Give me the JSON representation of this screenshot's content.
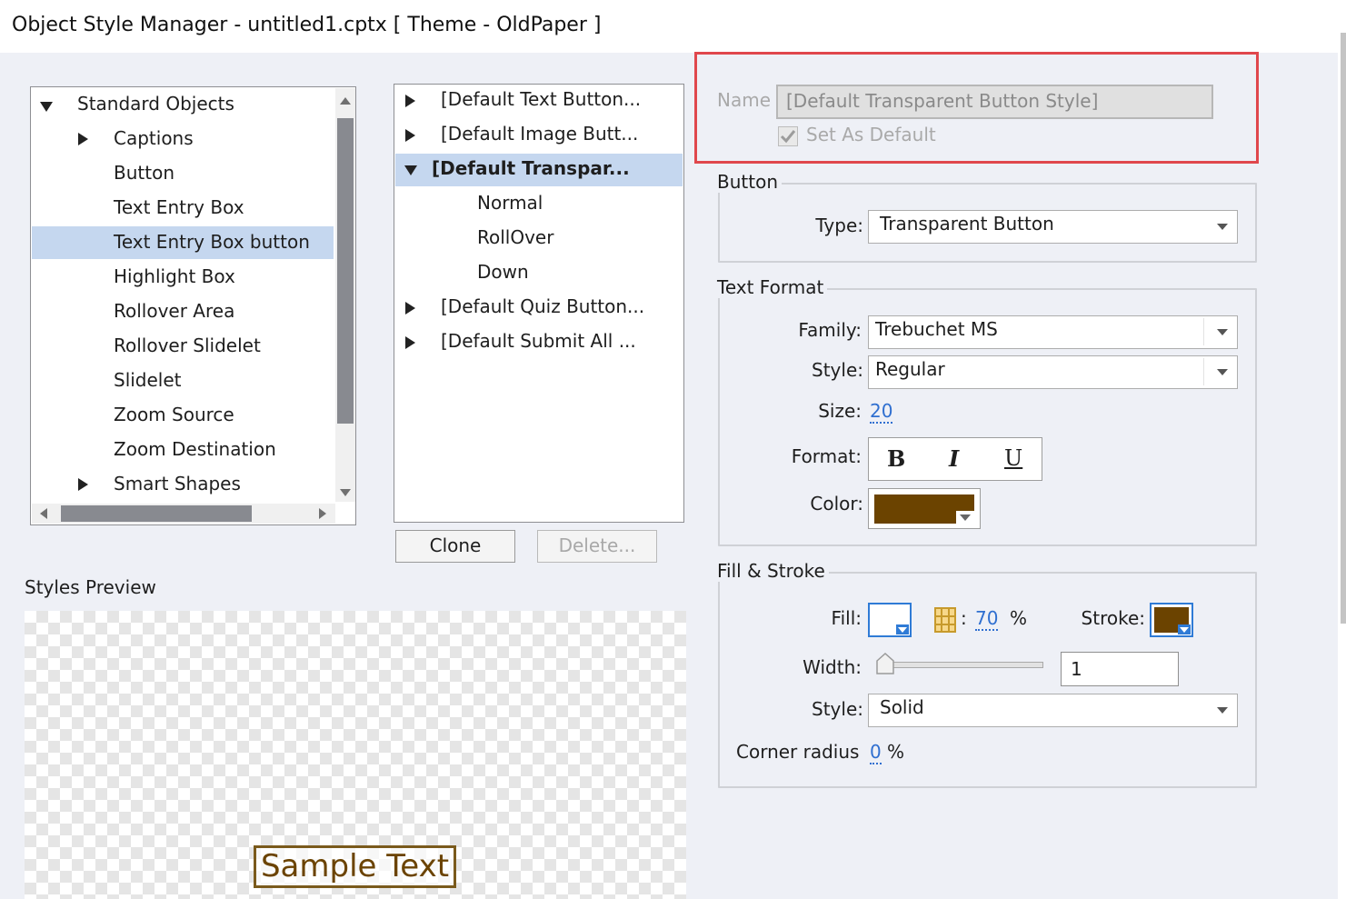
{
  "window": {
    "title": "Object Style Manager - untitled1.cptx [ Theme - OldPaper ]"
  },
  "categories": {
    "root": "Standard Objects",
    "items": [
      {
        "label": "Captions",
        "expandable": true
      },
      {
        "label": "Button",
        "expandable": false
      },
      {
        "label": "Text Entry Box",
        "expandable": false
      },
      {
        "label": "Text Entry Box button",
        "expandable": false,
        "selected": true
      },
      {
        "label": "Highlight Box",
        "expandable": false
      },
      {
        "label": "Rollover Area",
        "expandable": false
      },
      {
        "label": "Rollover Slidelet",
        "expandable": false
      },
      {
        "label": "Slidelet",
        "expandable": false
      },
      {
        "label": "Zoom Source",
        "expandable": false
      },
      {
        "label": "Zoom Destination",
        "expandable": false
      },
      {
        "label": "Smart Shapes",
        "expandable": true
      }
    ]
  },
  "styles": {
    "items": [
      {
        "label": "[Default Text Button..."
      },
      {
        "label": "[Default Image Butt..."
      },
      {
        "label": "[Default Transpar...",
        "selected": true,
        "expanded": true
      },
      {
        "label": "Normal",
        "child": true
      },
      {
        "label": "RollOver",
        "child": true
      },
      {
        "label": "Down",
        "child": true
      },
      {
        "label": "[Default Quiz Button..."
      },
      {
        "label": "[Default Submit All ..."
      }
    ],
    "clone_label": "Clone",
    "delete_label": "Delete..."
  },
  "preview": {
    "label": "Styles Preview",
    "sample_text": "Sample Text"
  },
  "name_section": {
    "name_label": "Name",
    "name_value": "[Default Transparent Button Style]",
    "set_default_label": "Set As Default"
  },
  "button_group": {
    "title": "Button",
    "type_label": "Type:",
    "type_value": "Transparent Button"
  },
  "text_format": {
    "title": "Text Format",
    "family_label": "Family:",
    "family_value": "Trebuchet MS",
    "style_label": "Style:",
    "style_value": "Regular",
    "size_label": "Size:",
    "size_value": "20",
    "format_label": "Format:",
    "bold": "B",
    "italic": "I",
    "underline": "U",
    "color_label": "Color:",
    "color_value": "#6b4300"
  },
  "fill_stroke": {
    "title": "Fill & Stroke",
    "fill_label": "Fill:",
    "fill_color": "#ffffff",
    "alpha_sep": ":",
    "alpha_value": "70",
    "alpha_unit": "%",
    "stroke_label": "Stroke:",
    "stroke_color": "#6b4300",
    "width_label": "Width:",
    "width_value": "1",
    "width_slider_fraction": 0.0,
    "style_label": "Style:",
    "style_value": "Solid",
    "corner_label": "Corner radius",
    "corner_value": "0",
    "corner_unit": "%"
  },
  "colors": {
    "selection": "#c5d7ef",
    "highlight_box": "#e0474c",
    "accent_link": "#2f6fd0"
  }
}
